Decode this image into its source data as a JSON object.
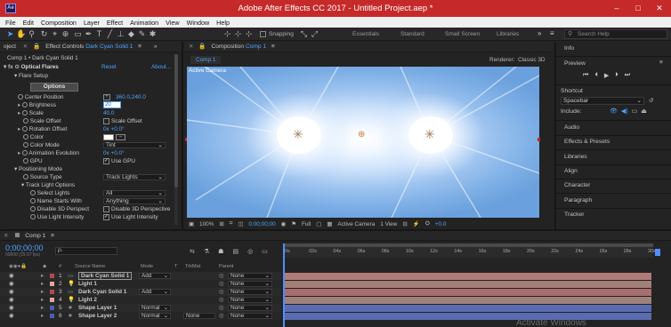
{
  "app": {
    "title": "Adobe After Effects CC 2017 - Untitled Project.aep *",
    "logo": "Ae"
  },
  "window_controls": [
    "–",
    "□",
    "✕"
  ],
  "menu": [
    "File",
    "Edit",
    "Composition",
    "Layer",
    "Effect",
    "Animation",
    "View",
    "Window",
    "Help"
  ],
  "toolbar": {
    "snapping": "Snapping",
    "workspaces": [
      "Essentials",
      "Standard",
      "Small Screen",
      "Libraries"
    ],
    "search_placeholder": "Search Help"
  },
  "effect_controls": {
    "tab_project": "oject",
    "tab_label": "Effect Controls",
    "tab_layer": "Dark Cyan Solid 1",
    "breadcrumb": "Comp 1 • Dark Cyan Solid 1",
    "effect_name": "Optical Flares",
    "reset": "Reset",
    "about": "About...",
    "flare_setup": "Flare Setup",
    "options_button": "Options",
    "props": [
      {
        "label": "Center Position",
        "value": "360.0,240.0"
      },
      {
        "label": "Brightness",
        "value": "20"
      },
      {
        "label": "Scale",
        "value": "40.0"
      },
      {
        "label": "Scale Offset",
        "value": "Scale Offset"
      },
      {
        "label": "Rotation Offset",
        "value": "0x +0.0°"
      },
      {
        "label": "Color",
        "value": ""
      },
      {
        "label": "Color Mode",
        "value": "Tint"
      },
      {
        "label": "Animation Evolution",
        "value": "0x +0.0°"
      },
      {
        "label": "GPU",
        "value": "Use GPU"
      }
    ],
    "positioning_mode": "Positioning Mode",
    "source_type": {
      "label": "Source Type",
      "value": "Track Lights"
    },
    "track_light_options": "Track Light Options",
    "select_lights": {
      "label": "Select Lights",
      "value": "All"
    },
    "name_starts_with": {
      "label": "Name Starts With",
      "value": "Anything"
    },
    "disable_3d_perspect": {
      "label": "Disable 3D Perspect",
      "value": "Disable 3D Perspective"
    },
    "use_light_intensity": {
      "label": "Use Light Intensity",
      "value": "Use Light Intensity"
    }
  },
  "composition": {
    "tab_label": "Composition",
    "tab_comp": "Comp 1",
    "sub_tab": "Comp 1",
    "renderer": "Renderer:",
    "renderer_value": "Classic 3D",
    "camera_label": "Active Camera",
    "zoom": "100%",
    "timecode": "0;00;00;00",
    "resolution": "Full",
    "camera_select": "Active Camera",
    "view_select": "1 View",
    "exposure": "+0.0"
  },
  "right_panel": {
    "info": "Info",
    "preview": "Preview",
    "shortcut_label": "Shortcut",
    "shortcut_value": "Spacebar",
    "include_label": "Include:",
    "items": [
      "Audio",
      "Effects & Presets",
      "Libraries",
      "Align",
      "Character",
      "Paragraph",
      "Tracker"
    ]
  },
  "timeline": {
    "tab": "Comp 1",
    "timecode": "0;00;00;00",
    "fps": "00000 (29.97 fps)",
    "search_placeholder": "ρ.",
    "columns": {
      "num": "#",
      "source": "Source Name",
      "mode": "Mode",
      "t": "T",
      "trkmat": "TrkMat",
      "parent": "Parent"
    },
    "ruler": [
      "0s",
      "02s",
      "04s",
      "06s",
      "08s",
      "10s",
      "12s",
      "14s",
      "16s",
      "18s",
      "20s",
      "22s",
      "24s",
      "26s",
      "28s",
      "30s"
    ],
    "layers": [
      {
        "num": "1",
        "name": "Dark Cyan Solid 1",
        "mode": "Add",
        "trkmat": "",
        "parent": "None",
        "color": "#b04e4e",
        "bar": "#b07a79"
      },
      {
        "num": "2",
        "name": "Light 1",
        "mode": "",
        "trkmat": "",
        "parent": "None",
        "color": "#d9a9a4",
        "bar": "#a27f78"
      },
      {
        "num": "3",
        "name": "Dark Cyan Solid 1",
        "mode": "Add",
        "trkmat": "",
        "parent": "None",
        "color": "#b04e4e",
        "bar": "#a86d6e"
      },
      {
        "num": "4",
        "name": "Light 2",
        "mode": "",
        "trkmat": "",
        "parent": "None",
        "color": "#d9a9a4",
        "bar": "#a0807a"
      },
      {
        "num": "5",
        "name": "Shape Layer 1",
        "mode": "Normal",
        "trkmat": "",
        "parent": "None",
        "color": "#4c5fb6",
        "bar": "#5a6bb2"
      },
      {
        "num": "6",
        "name": "Shape Layer 2",
        "mode": "Normal",
        "trkmat": "None",
        "parent": "None",
        "color": "#4c5fb6",
        "bar": "#5a6bb2"
      }
    ],
    "watermark": "Activate Windows"
  },
  "colors": {
    "titlebar": "#c62929",
    "accent": "#4fa3ff",
    "playhead": "#4f8fff"
  }
}
